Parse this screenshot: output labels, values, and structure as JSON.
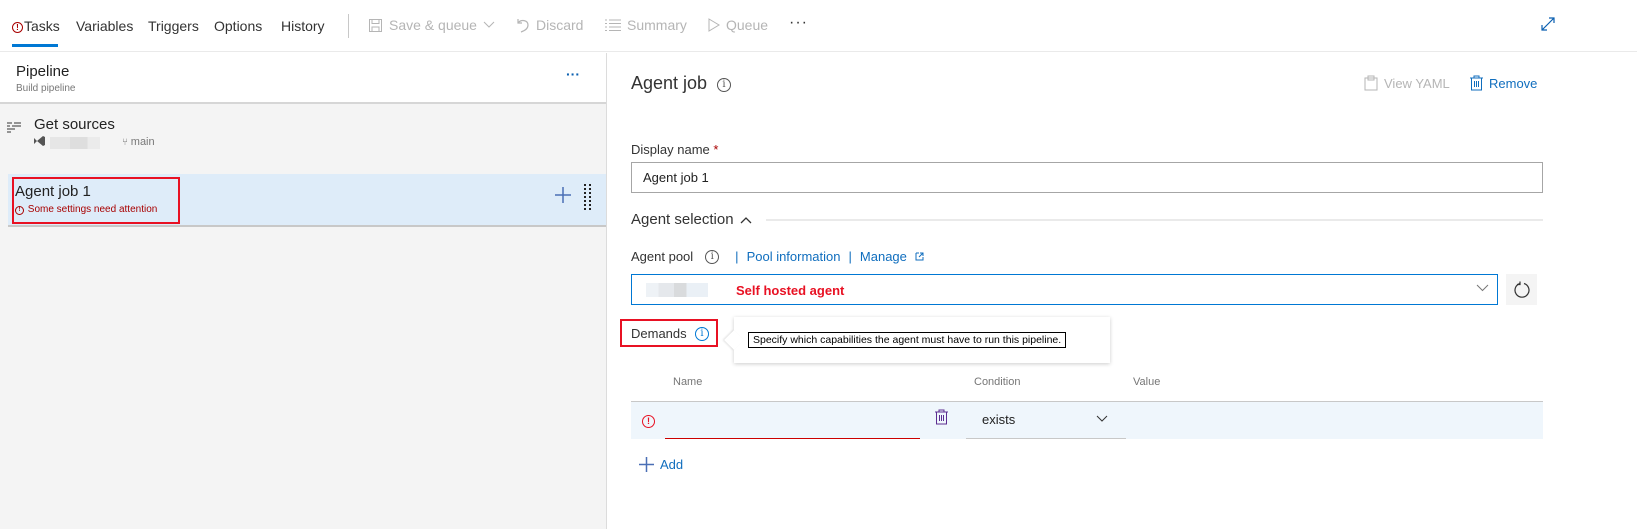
{
  "toolbar": {
    "tabs": [
      {
        "label": "Tasks",
        "active": true,
        "warning": true
      },
      {
        "label": "Variables"
      },
      {
        "label": "Triggers"
      },
      {
        "label": "Options"
      },
      {
        "label": "History"
      }
    ],
    "actions": {
      "save_queue": "Save & queue",
      "discard": "Discard",
      "summary": "Summary",
      "queue": "Queue",
      "more": "···"
    }
  },
  "left": {
    "pipeline": {
      "title": "Pipeline",
      "subtitle": "Build pipeline",
      "more": "···"
    },
    "get_sources": {
      "title": "Get sources",
      "branch": "main"
    },
    "agent_job": {
      "title": "Agent job 1",
      "warning": "Some settings need attention"
    }
  },
  "right": {
    "title": "Agent job",
    "view_yaml": "View YAML",
    "remove": "Remove",
    "display_name": {
      "label": "Display name",
      "required": "*",
      "value": "Agent job 1"
    },
    "agent_selection": {
      "label": "Agent selection"
    },
    "agent_pool": {
      "label": "Agent pool",
      "pool_information": "Pool information",
      "manage": "Manage",
      "separator": "|",
      "selected": "Self hosted agent"
    },
    "demands": {
      "label": "Demands",
      "tooltip": "Specify which capabilities the agent must have to run this pipeline.",
      "columns": {
        "name": "Name",
        "condition": "Condition",
        "value": "Value"
      },
      "rows": [
        {
          "name": "",
          "condition": "exists",
          "value": ""
        }
      ],
      "add": "Add"
    }
  },
  "colors": {
    "accent": "#0078d4",
    "link": "#106ebe",
    "error": "#e81123",
    "selected_row": "#deecf9"
  }
}
